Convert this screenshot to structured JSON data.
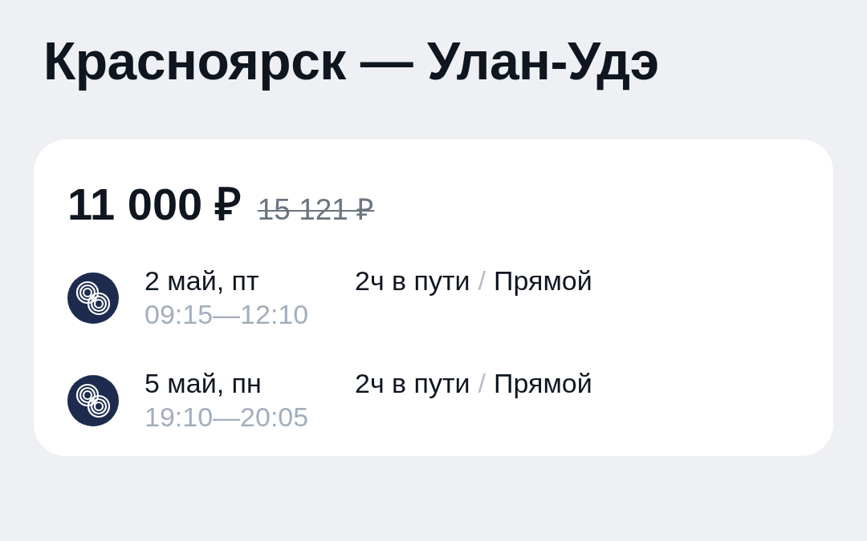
{
  "title": "Красноярск — Улан-Удэ",
  "offer": {
    "price": "11 000 ₽",
    "old_price": "15 121 ₽",
    "flights": [
      {
        "date": "2 май, пт",
        "times": "09:15—12:10",
        "duration": "2ч в пути",
        "separator": "/",
        "type": "Прямой"
      },
      {
        "date": "5 май, пн",
        "times": "19:10—20:05",
        "duration": "2ч в пути",
        "separator": "/",
        "type": "Прямой"
      }
    ]
  }
}
